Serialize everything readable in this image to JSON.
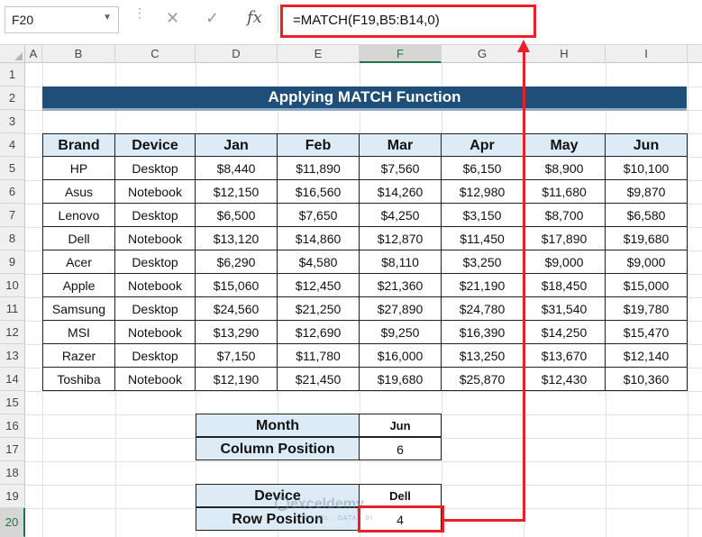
{
  "formula_bar": {
    "name_box": "F20",
    "cancel_icon": "✕",
    "enter_icon": "✓",
    "fx_label": "fx",
    "formula": "=MATCH(F19,B5:B14,0)"
  },
  "columns": [
    "A",
    "B",
    "C",
    "D",
    "E",
    "F",
    "G",
    "H",
    "I"
  ],
  "rows": [
    "1",
    "2",
    "3",
    "4",
    "5",
    "6",
    "7",
    "8",
    "9",
    "10",
    "11",
    "12",
    "13",
    "14",
    "15",
    "16",
    "17",
    "18",
    "19",
    "20"
  ],
  "selected_column": "F",
  "selected_row": "20",
  "title": "Applying MATCH Function",
  "table": {
    "headers": [
      "Brand",
      "Device",
      "Jan",
      "Feb",
      "Mar",
      "Apr",
      "May",
      "Jun"
    ],
    "rows": [
      [
        "HP",
        "Desktop",
        "$8,440",
        "$11,890",
        "$7,560",
        "$6,150",
        "$8,900",
        "$10,100"
      ],
      [
        "Asus",
        "Notebook",
        "$12,150",
        "$16,560",
        "$14,260",
        "$12,980",
        "$11,680",
        "$9,870"
      ],
      [
        "Lenovo",
        "Desktop",
        "$6,500",
        "$7,650",
        "$4,250",
        "$3,150",
        "$8,700",
        "$6,580"
      ],
      [
        "Dell",
        "Notebook",
        "$13,120",
        "$14,860",
        "$12,870",
        "$11,450",
        "$17,890",
        "$19,680"
      ],
      [
        "Acer",
        "Desktop",
        "$6,290",
        "$4,580",
        "$8,110",
        "$3,250",
        "$9,000",
        "$9,000"
      ],
      [
        "Apple",
        "Notebook",
        "$15,060",
        "$12,450",
        "$21,360",
        "$21,190",
        "$18,450",
        "$15,000"
      ],
      [
        "Samsung",
        "Desktop",
        "$24,560",
        "$21,250",
        "$27,890",
        "$24,780",
        "$31,540",
        "$19,780"
      ],
      [
        "MSI",
        "Notebook",
        "$13,290",
        "$12,690",
        "$9,250",
        "$16,390",
        "$14,250",
        "$15,470"
      ],
      [
        "Razer",
        "Desktop",
        "$7,150",
        "$11,780",
        "$16,000",
        "$13,250",
        "$13,670",
        "$12,140"
      ],
      [
        "Toshiba",
        "Notebook",
        "$12,190",
        "$21,450",
        "$19,680",
        "$25,870",
        "$12,430",
        "$10,360"
      ]
    ]
  },
  "lookup1": {
    "month_label": "Month",
    "month_value": "Jun",
    "colpos_label": "Column Position",
    "colpos_value": "6"
  },
  "lookup2": {
    "device_label": "Device",
    "device_value": "Dell",
    "rowpos_label": "Row Position",
    "rowpos_value": "4"
  },
  "watermark": {
    "name": "exceldemy",
    "tagline": "EXCEL · DATA · BI"
  },
  "colors": {
    "title_bg": "#1f4e79",
    "header_bg": "#ddebf7",
    "highlight": "#e8202a",
    "selected_header": "#217346"
  }
}
